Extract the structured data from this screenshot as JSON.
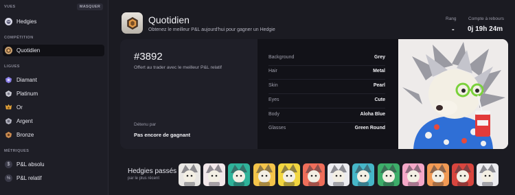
{
  "sidebar": {
    "views_label": "VUES",
    "hide_label": "MASQUER",
    "views": [
      {
        "label": "Hedgies",
        "icon": "hedgie-icon"
      }
    ],
    "competition_label": "COMPÉTITION",
    "competition": [
      {
        "label": "Quotidien",
        "icon": "daily-medal-icon",
        "active": true
      }
    ],
    "leagues_label": "LIGUES",
    "leagues": [
      {
        "label": "Diamant",
        "icon": "diamond-league-icon",
        "color": "#8b7fe8"
      },
      {
        "label": "Platinum",
        "icon": "platinum-league-icon",
        "color": "#c9c9d2"
      },
      {
        "label": "Or",
        "icon": "gold-league-icon",
        "color": "#e2a23a"
      },
      {
        "label": "Argent",
        "icon": "silver-league-icon",
        "color": "#b6b6c2"
      },
      {
        "label": "Bronze",
        "icon": "bronze-league-icon",
        "color": "#c98a50"
      }
    ],
    "metrics_label": "MÉTRIQUES",
    "metrics": [
      {
        "label": "P&L absolu",
        "icon": "dollar-icon"
      },
      {
        "label": "P&L relatif",
        "icon": "percent-icon"
      }
    ]
  },
  "header": {
    "title": "Quotidien",
    "subtitle": "Obtenez le meilleur P&L aujourd'hui pour gagner un Hedgie",
    "rank_label": "Rang",
    "rank_value": "-",
    "countdown_label": "Compte à rebours",
    "countdown_value": "0j 19h 24m"
  },
  "card": {
    "id": "#3892",
    "description": "Offert au trader avec le meilleur P&L relatif",
    "held_label": "Détenu par",
    "held_value": "Pas encore de gagnant",
    "traits": [
      {
        "key": "Background",
        "value": "Grey"
      },
      {
        "key": "Hair",
        "value": "Metal"
      },
      {
        "key": "Skin",
        "value": "Pearl"
      },
      {
        "key": "Eyes",
        "value": "Cute"
      },
      {
        "key": "Body",
        "value": "Aloha Blue"
      },
      {
        "key": "Glasses",
        "value": "Green Round"
      }
    ]
  },
  "past": {
    "title": "Hedgies passés",
    "subtitle": "par le plus récent",
    "thumb_colors": [
      "#e9e7e4",
      "#f2e7ea",
      "#2fb39a",
      "#f4c44a",
      "#f2d640",
      "#f06e5a",
      "#ececf0",
      "#46b6c8",
      "#3dae6a",
      "#f4a8c8",
      "#f29a54",
      "#d8453e",
      "#ececf0"
    ]
  },
  "accent": "#e2a23a"
}
